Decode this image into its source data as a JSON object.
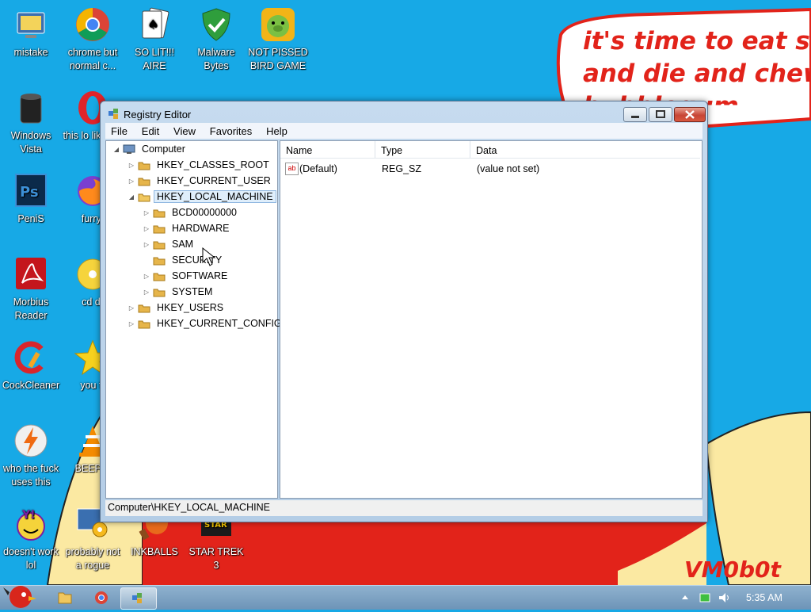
{
  "desktop": {
    "wallpaper_text": [
      "it's time to eat shit",
      "and die and chew",
      "bubblegum"
    ],
    "wallpaper_signature": "VM0b0t",
    "icons": [
      {
        "name": "mistake",
        "label": "mistake",
        "icon": "monitor-icon"
      },
      {
        "name": "chrome",
        "label": "chrome but normal c...",
        "icon": "chrome-icon"
      },
      {
        "name": "solitaire",
        "label": "SO LIT!!! AIRE",
        "icon": "cards-icon"
      },
      {
        "name": "malwarebytes",
        "label": "Malware Bytes",
        "icon": "shield-icon"
      },
      {
        "name": "pigs",
        "label": "NOT PISSED BIRD GAME",
        "icon": "pig-icon"
      },
      {
        "name": "vista",
        "label": "Windows Vista",
        "icon": "trash-icon"
      },
      {
        "name": "opera",
        "label": "this lo like a v",
        "icon": "opera-icon"
      },
      {
        "name": "photoshop",
        "label": "PeniS",
        "icon": "photoshop-icon"
      },
      {
        "name": "firefox",
        "label": "furryf",
        "icon": "firefox-icon"
      },
      {
        "name": "acrobat",
        "label": "Morbius Reader",
        "icon": "acrobat-icon"
      },
      {
        "name": "cd",
        "label": "cd dr",
        "icon": "cd-icon"
      },
      {
        "name": "ccleaner",
        "label": "CockCleaner",
        "icon": "ccleaner-icon"
      },
      {
        "name": "star",
        "label": "you tr",
        "icon": "star-icon"
      },
      {
        "name": "winamp",
        "label": "who the fuck uses this",
        "icon": "winamp-icon"
      },
      {
        "name": "vlc",
        "label": "BEEP B",
        "icon": "vlc-icon"
      },
      {
        "name": "yahoo",
        "label": "doesn't work lol",
        "icon": "yahoo-icon"
      },
      {
        "name": "rogue",
        "label": "probably not a rogue",
        "icon": "monitor-gear-icon"
      },
      {
        "name": "inkballs",
        "label": "INKBALLS",
        "icon": "inkball-icon"
      },
      {
        "name": "startrek",
        "label": "STAR TREK 3",
        "icon": "starwars-icon"
      }
    ]
  },
  "window": {
    "title": "Registry Editor",
    "menu": [
      "File",
      "Edit",
      "View",
      "Favorites",
      "Help"
    ],
    "tree": {
      "root": "Computer",
      "hives": [
        "HKEY_CLASSES_ROOT",
        "HKEY_CURRENT_USER",
        "HKEY_LOCAL_MACHINE"
      ],
      "hklm_children": [
        "BCD00000000",
        "HARDWARE",
        "SAM",
        "SECURITY",
        "SOFTWARE",
        "SYSTEM"
      ],
      "after": [
        "HKEY_USERS",
        "HKEY_CURRENT_CONFIG"
      ]
    },
    "columns": {
      "name": "Name",
      "type": "Type",
      "data": "Data"
    },
    "values": [
      {
        "name": "(Default)",
        "type": "REG_SZ",
        "data": "(value not set)",
        "icon_text": "ab"
      }
    ],
    "status": "Computer\\HKEY_LOCAL_MACHINE"
  },
  "taskbar": {
    "clock": "5:35 AM"
  },
  "colors": {
    "desktop_bg": "#17a9e6",
    "wallpaper_red": "#e2231a",
    "wallpaper_skin": "#fbe9a2"
  }
}
